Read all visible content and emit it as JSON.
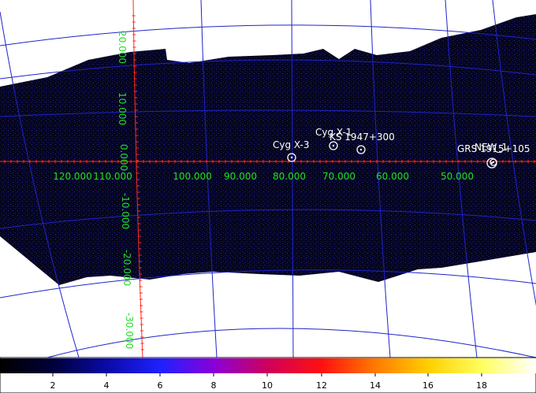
{
  "image": {
    "kind": "sky-mosaic",
    "background_color": "#ffffff",
    "exposure_color": "#05051e",
    "grid_color": "#1f24c8",
    "axis_color": "#ff2a1a",
    "label_color": "#22e022",
    "source_color": "#ffffff"
  },
  "longitude_labels": [
    "120.000",
    "110.000",
    "100.000",
    "90.000",
    "80.000",
    "70.000",
    "60.000",
    "50.000"
  ],
  "latitude_labels": [
    "20.000",
    "10.000",
    "0.000",
    "-10.000",
    "-20.000",
    "-30.000"
  ],
  "sources": [
    {
      "name": "Cyg X-3"
    },
    {
      "name": "Cyg X-1"
    },
    {
      "name": "KS 1947+300"
    },
    {
      "name": "GRS 1915+105"
    },
    {
      "name": "NEW_1"
    }
  ],
  "colorbar": {
    "labels": [
      "2",
      "4",
      "6",
      "8",
      "10",
      "12",
      "14",
      "16",
      "18"
    ],
    "stops": [
      "#000000",
      "#00003a",
      "#0a0aa8",
      "#2020ff",
      "#8a00d8",
      "#d0005a",
      "#ff1010",
      "#ff7a00",
      "#ffd000",
      "#ffff60",
      "#ffffff"
    ]
  }
}
